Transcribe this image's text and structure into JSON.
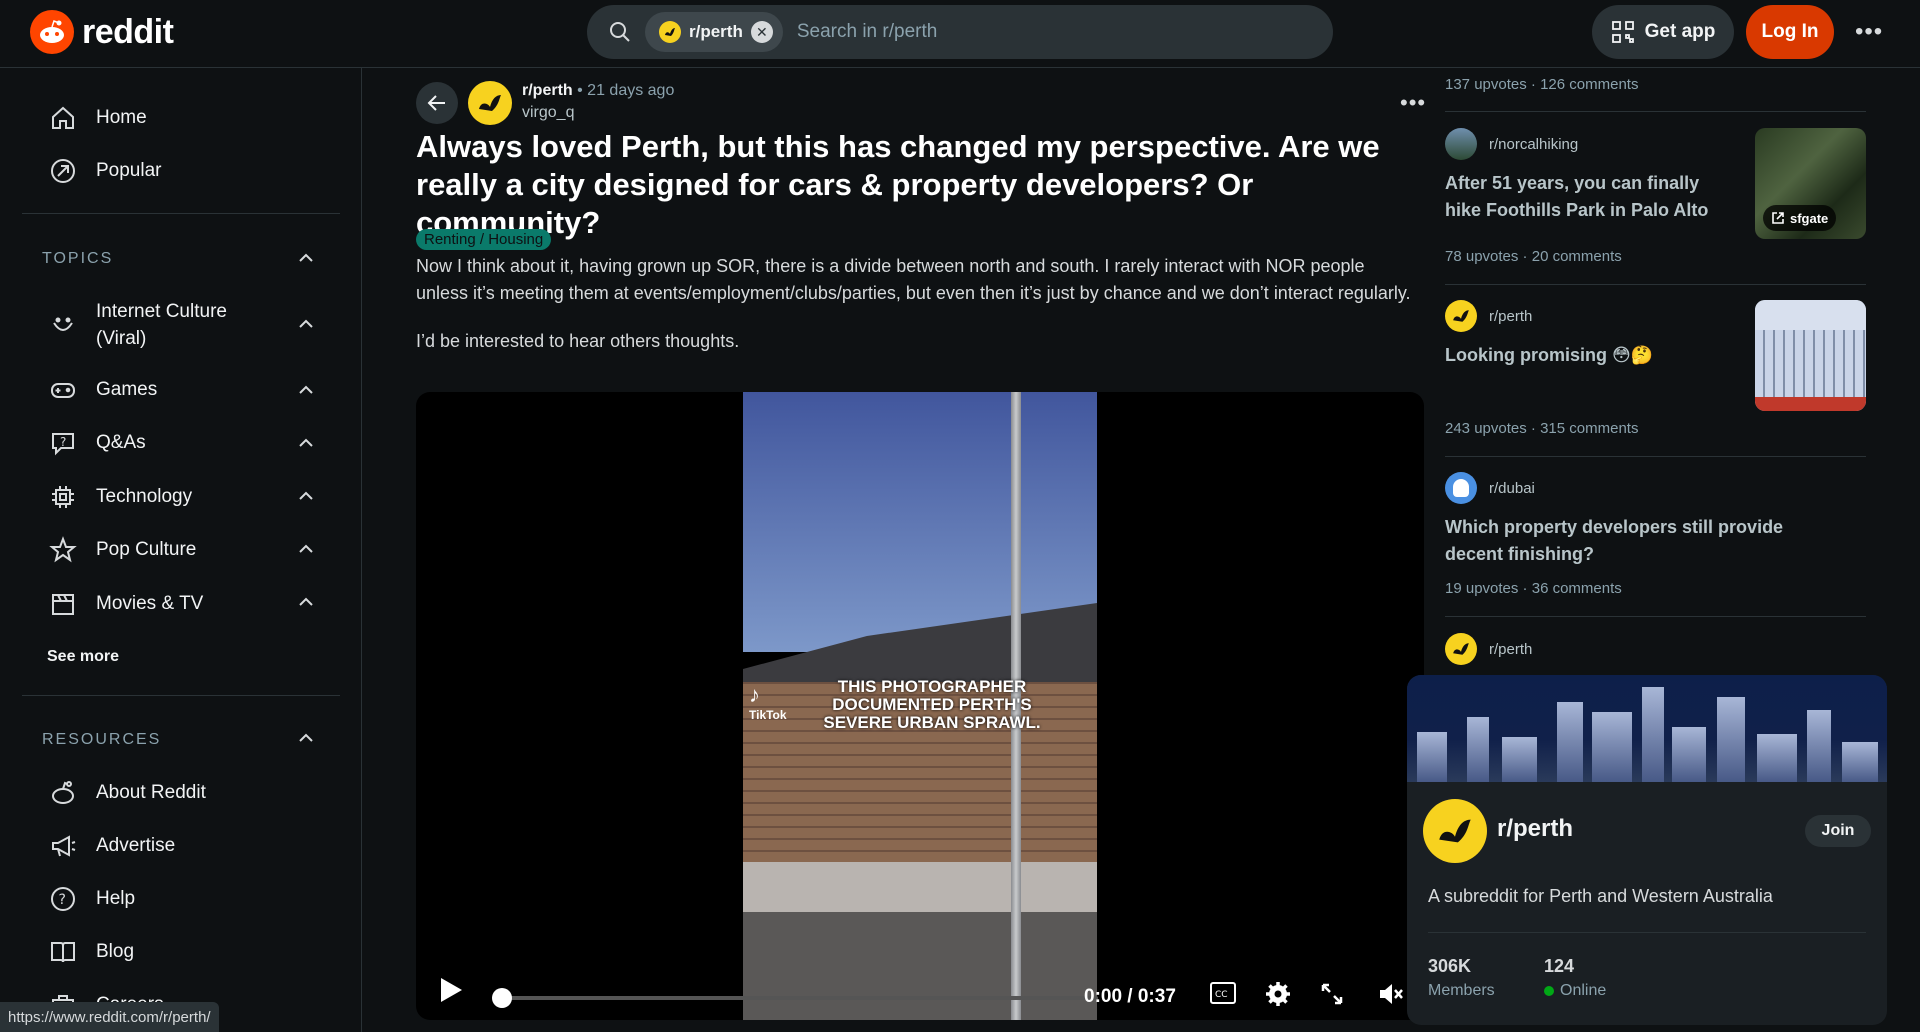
{
  "header": {
    "logo_text": "reddit",
    "search_chip": "r/perth",
    "search_placeholder": "Search in r/perth",
    "get_app": "Get app",
    "login": "Log In"
  },
  "sidebar": {
    "home": "Home",
    "popular": "Popular",
    "topics_title": "TOPICS",
    "topics": [
      {
        "label": "Internet Culture (Viral)",
        "icon": "smile-icon"
      },
      {
        "label": "Games",
        "icon": "gamepad-icon"
      },
      {
        "label": "Q&As",
        "icon": "qa-icon"
      },
      {
        "label": "Technology",
        "icon": "chip-icon"
      },
      {
        "label": "Pop Culture",
        "icon": "star-icon"
      },
      {
        "label": "Movies & TV",
        "icon": "clapper-icon"
      }
    ],
    "see_more": "See more",
    "resources_title": "RESOURCES",
    "resources": [
      {
        "label": "About Reddit",
        "icon": "reddit-alien-icon"
      },
      {
        "label": "Advertise",
        "icon": "megaphone-icon"
      },
      {
        "label": "Help",
        "icon": "help-icon"
      },
      {
        "label": "Blog",
        "icon": "book-icon"
      },
      {
        "label": "Careers",
        "icon": "briefcase-icon"
      }
    ]
  },
  "status_url": "https://www.reddit.com/r/perth/",
  "post": {
    "subreddit": "r/perth",
    "age": "21 days ago",
    "author": "virgo_q",
    "title": "Always loved Perth, but this has changed my perspective. Are we really a city designed for cars & property developers? Or community?",
    "flair": "Renting / Housing",
    "body": [
      "Now I think about it, having grown up SOR, there is a divide between north and south. I rarely interact with NOR people unless it’s meeting them at events/employment/clubs/parties, but even then it’s just by chance and we don’t interact regularly.",
      "I’d be interested to hear others thoughts."
    ],
    "video": {
      "overlay_text": "THIS PHOTOGRAPHER DOCUMENTED PERTH'S SEVERE URBAN SPRAWL.",
      "tiktok_label": "TikTok",
      "time": "0:00 / 0:37",
      "progress": 0.0
    }
  },
  "related": {
    "top_stats": {
      "upvotes": "137 upvotes",
      "comments": "126 comments"
    },
    "items": [
      {
        "subreddit": "r/norcalhiking",
        "title": "After 51 years, you can finally hike Foothills Park in Palo Alto",
        "upvotes": "78 upvotes",
        "comments": "20 comments",
        "thumb_label": "sfgate"
      },
      {
        "subreddit": "r/perth",
        "title": "Looking promising 😳🤔",
        "upvotes": "243 upvotes",
        "comments": "315 comments"
      },
      {
        "subreddit": "r/dubai",
        "title": "Which property developers still provide decent finishing?",
        "upvotes": "19 upvotes",
        "comments": "36 comments"
      },
      {
        "subreddit": "r/perth"
      }
    ]
  },
  "community": {
    "name": "r/perth",
    "join": "Join",
    "description": "A subreddit for Perth and Western Australia",
    "members_value": "306K",
    "members_label": "Members",
    "online_value": "124",
    "online_label": "Online"
  }
}
